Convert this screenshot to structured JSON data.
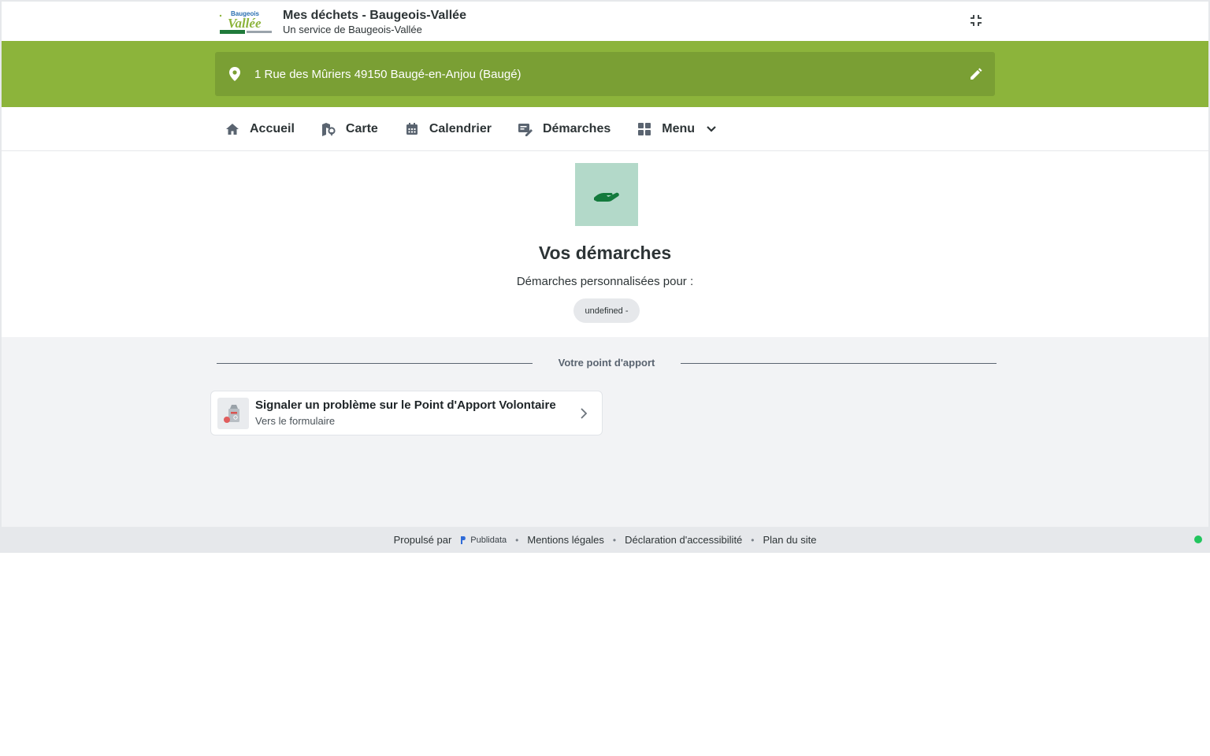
{
  "header": {
    "title": "Mes déchets - Baugeois-Vallée",
    "subtitle": "Un service de Baugeois-Vallée",
    "logo_text": "Baugeois Vallée",
    "compress_icon": "fullscreen-exit-icon"
  },
  "address": {
    "text": "1 Rue des Mûriers 49150 Baugé-en-Anjou (Baugé)",
    "icons": [
      "location-pin-icon",
      "edit-pencil-icon"
    ]
  },
  "nav": {
    "items": [
      {
        "label": "Accueil",
        "icon": "home-icon"
      },
      {
        "label": "Carte",
        "icon": "map-icon"
      },
      {
        "label": "Calendrier",
        "icon": "calendar-icon"
      },
      {
        "label": "Démarches",
        "icon": "form-edit-icon"
      },
      {
        "label": "Menu",
        "icon": "grid-icon"
      }
    ]
  },
  "hero": {
    "title": "Vos démarches",
    "subtitle": "Démarches personnalisées pour :",
    "chip": "undefined -",
    "icon": "hand-icon"
  },
  "section": {
    "label": "Votre point d'apport",
    "card": {
      "title": "Signaler un problème sur le Point d'Apport Volontaire",
      "subtitle": "Vers le formulaire",
      "icon": "recycling-container-icon"
    }
  },
  "footer": {
    "powered_by": "Propulsé par",
    "brand": "Publidata",
    "links": [
      "Mentions légales",
      "Déclaration d'accessibilité",
      "Plan du site"
    ]
  },
  "colors": {
    "brand_green": "#8cb43b",
    "address_bar": "#7a9f34",
    "hero_icon_bg": "#b3d9c9",
    "hero_icon_fg": "#137a3c",
    "status_green": "#22c55e"
  }
}
